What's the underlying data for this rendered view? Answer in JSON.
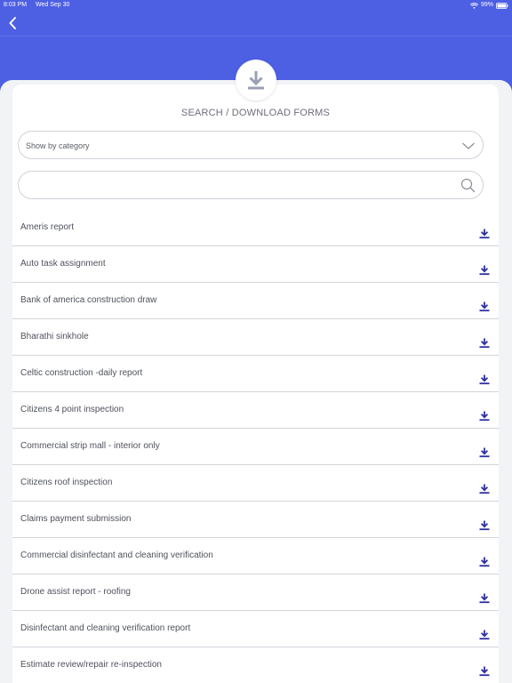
{
  "status_bar": {
    "time": "8:03 PM",
    "date": "Wed Sep 30",
    "battery": "99%"
  },
  "colors": {
    "header": "#4d5fe3",
    "accent_icon": "#2e2fa0",
    "badge_icon": "#9aa0b4"
  },
  "page": {
    "title": "SEARCH / DOWNLOAD FORMS"
  },
  "category_select": {
    "label": "Show by category"
  },
  "search": {
    "value": "",
    "placeholder": ""
  },
  "icons": {
    "back": "chevron-left-icon",
    "badge": "download-icon",
    "dropdown": "chevron-down-icon",
    "search": "search-icon",
    "row_action": "download-icon"
  },
  "forms": [
    {
      "name": "Ameris report"
    },
    {
      "name": "Auto task assignment"
    },
    {
      "name": "Bank of america construction draw"
    },
    {
      "name": "Bharathi sinkhole"
    },
    {
      "name": "Celtic construction -daily report"
    },
    {
      "name": "Citizens 4 point inspection"
    },
    {
      "name": "Commercial strip mall - interior only"
    },
    {
      "name": "Citizens roof inspection"
    },
    {
      "name": "Claims payment submission"
    },
    {
      "name": "Commercial disinfectant and cleaning verification"
    },
    {
      "name": "Drone assist report - roofing"
    },
    {
      "name": "Disinfectant and cleaning verification report"
    },
    {
      "name": "Estimate review/repair re-inspection"
    }
  ]
}
